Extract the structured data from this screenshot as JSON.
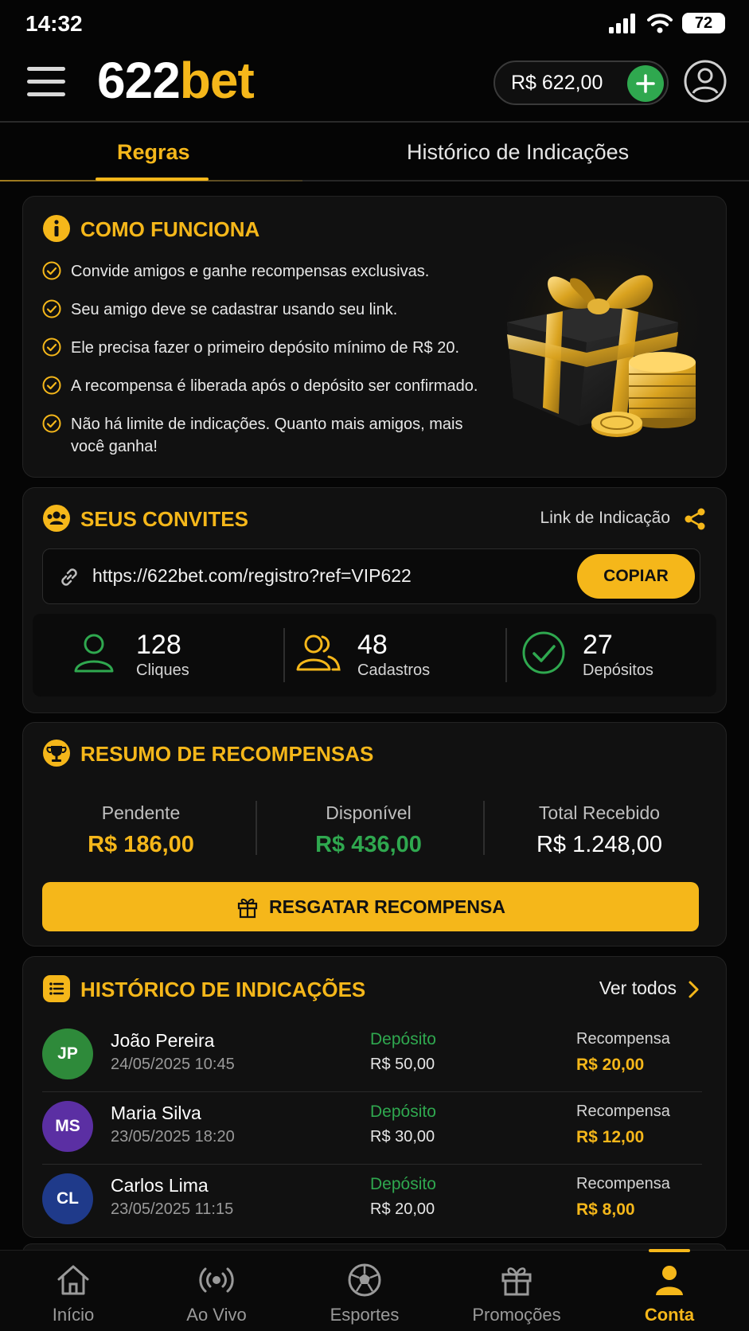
{
  "status_bar": {
    "time": "14:32",
    "battery": "72"
  },
  "header": {
    "logo_number": "622",
    "logo_brand": "bet",
    "balance": "R$ 622,00"
  },
  "tabs": [
    {
      "label": "Regras",
      "active": true
    },
    {
      "label": "Histórico de Indicações",
      "active": false
    }
  ],
  "how_it_works": {
    "title": "COMO FUNCIONA",
    "items": [
      "Convide amigos e ganhe recompensas exclusivas.",
      "Seu amigo deve se cadastrar usando seu link.",
      "Ele precisa fazer o primeiro depósito mínimo de R$ 20.",
      "A recompensa é liberada após o depósito ser confirmado.",
      "Não há limite de indicações. Quanto mais amigos, mais você ganha!"
    ]
  },
  "invites": {
    "title": "SEUS CONVITES",
    "link_label": "Link de Indicação",
    "url": "https://622bet.com/registro?ref=VIP622",
    "copy_label": "COPIAR",
    "stats": [
      {
        "value": "128",
        "label": "Cliques",
        "icon": "user-icon"
      },
      {
        "value": "48",
        "label": "Cadastros",
        "icon": "users-icon"
      },
      {
        "value": "27",
        "label": "Depósitos",
        "icon": "check-circle-icon"
      }
    ]
  },
  "rewards_summary": {
    "title": "RESUMO DE RECOMPENSAS",
    "pending_label": "Pendente",
    "pending_value": "R$ 186,00",
    "available_label": "Disponível",
    "available_value": "R$ 436,00",
    "total_label": "Total Recebido",
    "total_value": "R$ 1.248,00",
    "redeem_label": "RESGATAR RECOMPENSA"
  },
  "referral_history": {
    "title": "HISTÓRICO DE INDICAÇÕES",
    "see_all": "Ver todos",
    "rows": [
      {
        "initials": "JP",
        "name": "João Pereira",
        "date": "24/05/2025 10:45",
        "type": "Depósito",
        "amount": "R$ 50,00",
        "reward_label": "Recompensa",
        "reward": "R$ 20,00",
        "color": "#2e8a3a"
      },
      {
        "initials": "MS",
        "name": "Maria Silva",
        "date": "23/05/2025 18:20",
        "type": "Depósito",
        "amount": "R$ 30,00",
        "reward_label": "Recompensa",
        "reward": "R$ 12,00",
        "color": "#5b2fa3"
      },
      {
        "initials": "CL",
        "name": "Carlos Lima",
        "date": "23/05/2025 11:15",
        "type": "Depósito",
        "amount": "R$ 20,00",
        "reward_label": "Recompensa",
        "reward": "R$ 8,00",
        "color": "#1f3a8a"
      }
    ]
  },
  "bottom_nav": [
    {
      "label": "Início",
      "icon": "home-icon",
      "active": false
    },
    {
      "label": "Ao Vivo",
      "icon": "live-icon",
      "active": false
    },
    {
      "label": "Esportes",
      "icon": "soccer-ball-icon",
      "active": false
    },
    {
      "label": "Promoções",
      "icon": "gift-icon",
      "active": false
    },
    {
      "label": "Conta",
      "icon": "account-icon",
      "active": true
    }
  ],
  "colors": {
    "accent": "#f5b71a",
    "success": "#2fa84f",
    "background": "#050505",
    "card": "#111111"
  }
}
